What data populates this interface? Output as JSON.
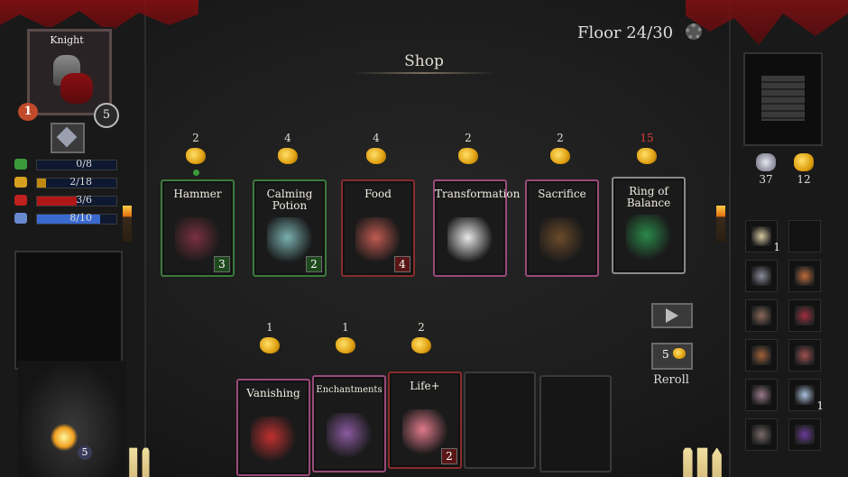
{
  "hud": {
    "title": "Shop",
    "floor": "Floor 24/30",
    "hero_name": "Knight",
    "hero_level": "5",
    "hero_left_num": "1",
    "altar_value": "5",
    "stats": [
      {
        "label": "0/8",
        "color": "#3a9a3a",
        "fill": 0.0,
        "bar": "#3a6a3a"
      },
      {
        "label": "2/18",
        "color": "#d8a020",
        "fill": 0.11,
        "bar": "#c08a10"
      },
      {
        "label": "3/6",
        "color": "#c02020",
        "fill": 0.5,
        "bar": "#b01818"
      },
      {
        "label": "8/10",
        "color": "#6a8ad0",
        "fill": 0.8,
        "bar": "#3a6ad0"
      }
    ],
    "currency": [
      {
        "icon": "silver-ore-icon",
        "amount": "37"
      },
      {
        "icon": "gold-nugget-icon",
        "amount": "12"
      }
    ],
    "reroll_cost": "5",
    "reroll_label": "Reroll"
  },
  "shop_items": [
    {
      "name": "Hammer",
      "price": "2",
      "count": "3",
      "border": "g",
      "art_color": "#7a3040",
      "price_red": false
    },
    {
      "name": "Calming Potion",
      "price": "4",
      "count": "2",
      "border": "g",
      "art_color": "#7ab0b0",
      "price_red": false
    },
    {
      "name": "Food",
      "price": "4",
      "count": "4",
      "border": "r",
      "art_color": "#c05a50",
      "price_red": false
    },
    {
      "name": "Transformation",
      "price": "2",
      "count": "",
      "border": "p",
      "art_color": "#e8e8e8",
      "price_red": false
    },
    {
      "name": "Sacrifice",
      "price": "2",
      "count": "",
      "border": "p",
      "art_color": "#6a4a2a",
      "price_red": false
    },
    {
      "name": "Ring of Balance",
      "price": "15",
      "count": "",
      "border": "w",
      "art_color": "#2a8a4a",
      "price_red": true
    }
  ],
  "upgrade_items": [
    {
      "name": "Vanishing",
      "price": "1",
      "count": "",
      "art_color": "#c03030"
    },
    {
      "name": "Enchantments",
      "price": "1",
      "count": "",
      "art_color": "#8a5aa0"
    },
    {
      "name": "Life+",
      "price": "2",
      "count": "2",
      "art_color": "#e07a8a"
    }
  ],
  "inventory": [
    {
      "icon": "bone-icon",
      "count": "1",
      "color": "#d8c8a0"
    },
    {
      "icon": "empty-icon",
      "count": "",
      "color": ""
    },
    {
      "icon": "axe-icon",
      "count": "",
      "color": "#8a8a9a"
    },
    {
      "icon": "claw-icon",
      "count": "",
      "color": "#c06a3a"
    },
    {
      "icon": "hammer-icon",
      "count": "",
      "color": "#8a6a5a"
    },
    {
      "icon": "scythe-icon",
      "count": "",
      "color": "#a03040"
    },
    {
      "icon": "meat-icon",
      "count": "",
      "color": "#a0603a"
    },
    {
      "icon": "sack-icon",
      "count": "",
      "color": "#a05050"
    },
    {
      "icon": "flask-icon",
      "count": "",
      "color": "#9a7a8a"
    },
    {
      "icon": "feather-icon",
      "count": "1",
      "color": "#aac0e0"
    },
    {
      "icon": "shield-icon",
      "count": "",
      "color": "#7a6a6a"
    },
    {
      "icon": "spider-icon",
      "count": "",
      "color": "#6a3a9a"
    }
  ]
}
